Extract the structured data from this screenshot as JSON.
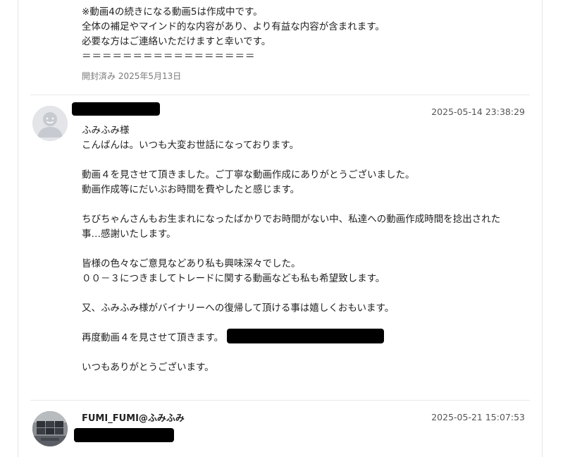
{
  "message_top": {
    "lines": [
      "※動画4の続きになる動画5は作成中です。",
      "全体の補足やマインド的な内容があり、より有益な内容が含まれます。",
      "必要な方はご連絡いただけますと幸いです。",
      "＝＝＝＝＝＝＝＝＝＝＝＝＝＝＝＝＝"
    ],
    "status": "開封済み 2025年5月13日"
  },
  "message_2": {
    "avatar_icon": "default-user-icon",
    "timestamp": "2025-05-14 23:38:29",
    "lines": [
      "ふみふみ様",
      "こんばんは。いつも大変お世話になっております。",
      "動画４を見させて頂きました。ご丁寧な動画作成にありがとうございました。",
      "動画作成等にだいぶお時間を費やしたと感じます。",
      "ちびちゃんさんもお生まれになったばかりでお時間がない中、私達への動画作成時間を捻出された",
      "事…感謝いたします。",
      "皆様の色々なご意見などあり私も興味深々でした。",
      "００－３につきましてトレードに関する動画なども私も希望致します。",
      "又、ふみふみ様がバイナリーへの復帰して頂ける事は嬉しくおもいます。",
      "再度動画４を見させて頂きます。",
      "いつもありがとうございます。"
    ]
  },
  "message_3": {
    "avatar_icon": "user-photo-avatar",
    "author": "FUMI_FUMI@ふみふみ",
    "timestamp": "2025-05-21 15:07:53"
  }
}
